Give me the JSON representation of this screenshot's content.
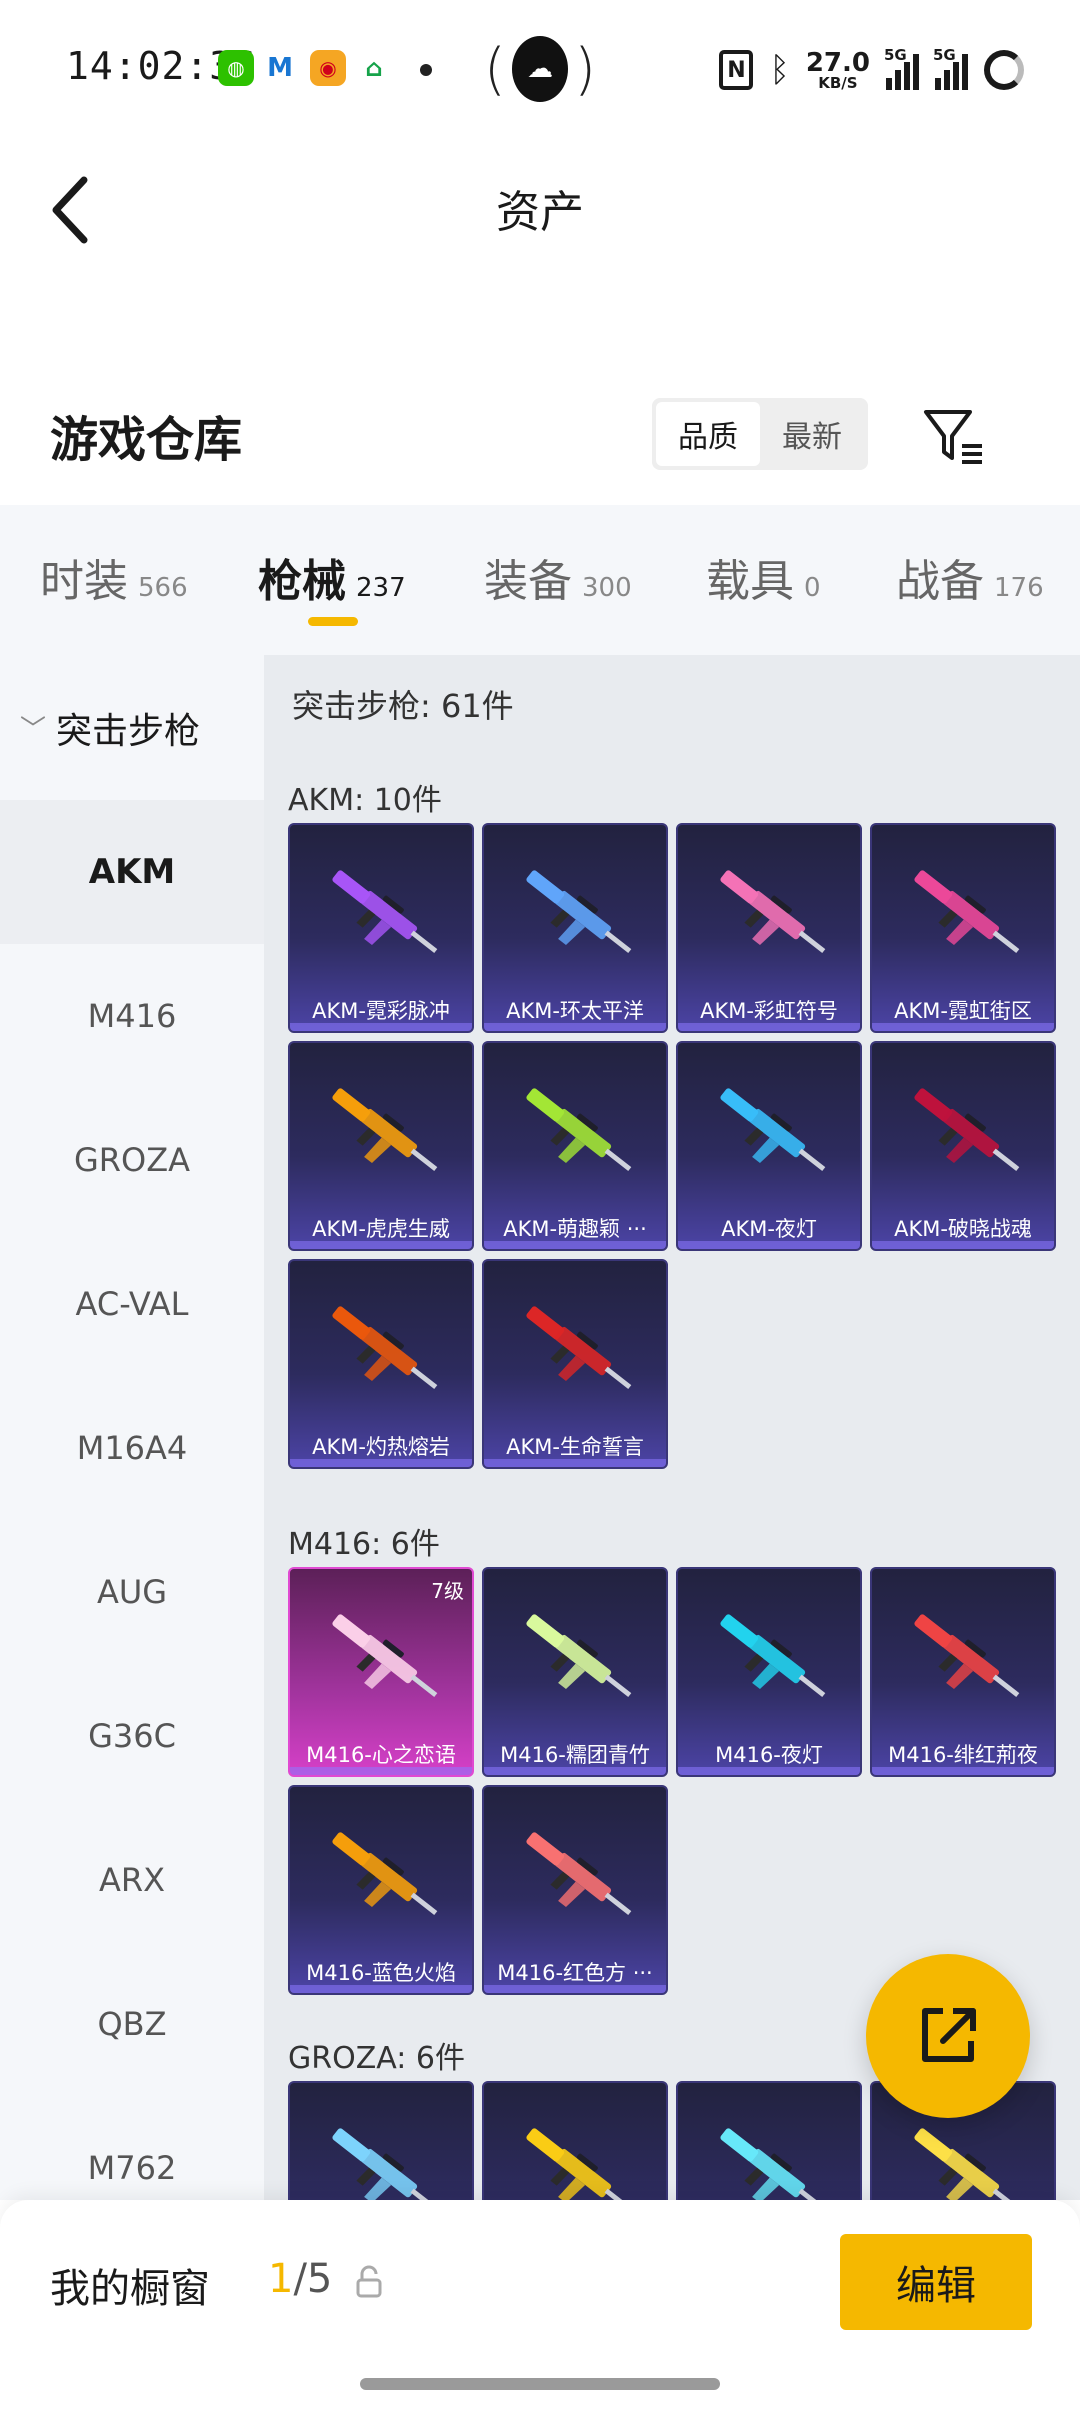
{
  "status_bar": {
    "time": "14:02:36",
    "net_speed_value": "27.0",
    "net_speed_unit": "KB/S",
    "sig1_label": "5G",
    "sig2_label": "5G"
  },
  "nav": {
    "title": "资产"
  },
  "header": {
    "title": "游戏仓库",
    "sort_options": [
      "品质",
      "最新"
    ]
  },
  "tabs": [
    {
      "label": "时装",
      "count": "566"
    },
    {
      "label": "枪械",
      "count": "237"
    },
    {
      "label": "装备",
      "count": "300"
    },
    {
      "label": "载具",
      "count": "0"
    },
    {
      "label": "战备",
      "count": "176"
    }
  ],
  "sidebar": {
    "category": "突击步枪",
    "items": [
      "AKM",
      "M416",
      "GROZA",
      "AC-VAL",
      "M16A4",
      "AUG",
      "G36C",
      "ARX",
      "QBZ",
      "M762"
    ]
  },
  "content": {
    "summary": "突击步枪: 61件",
    "groups": [
      {
        "title": "AKM: 10件",
        "items": [
          {
            "name": "AKM-霓彩脉冲",
            "accent": "#a855f7"
          },
          {
            "name": "AKM-环太平洋",
            "accent": "#60a5fa"
          },
          {
            "name": "AKM-彩虹符号",
            "accent": "#f472b6"
          },
          {
            "name": "AKM-霓虹街区",
            "accent": "#ec4899"
          },
          {
            "name": "AKM-虎虎生威",
            "accent": "#f59e0b"
          },
          {
            "name": "AKM-萌趣颖 ···",
            "accent": "#a3e635"
          },
          {
            "name": "AKM-夜灯",
            "accent": "#38bdf8"
          },
          {
            "name": "AKM-破晓战魂",
            "accent": "#be123c"
          },
          {
            "name": "AKM-灼热熔岩",
            "accent": "#ea580c"
          },
          {
            "name": "AKM-生命誓言",
            "accent": "#dc2626"
          }
        ]
      },
      {
        "title": "M416: 6件",
        "items": [
          {
            "name": "M416-心之恋语",
            "accent": "#fbcfe8",
            "level": "7级"
          },
          {
            "name": "M416-糯团青竹",
            "accent": "#d9f99d"
          },
          {
            "name": "M416-夜灯",
            "accent": "#22d3ee"
          },
          {
            "name": "M416-绯红荊夜",
            "accent": "#ef4444"
          },
          {
            "name": "M416-蓝色火焰",
            "accent": "#f59e0b"
          },
          {
            "name": "M416-红色方 ···",
            "accent": "#f87171"
          }
        ]
      },
      {
        "title": "GROZA: 6件",
        "items": [
          {
            "name": "",
            "accent": "#7dd3fc"
          },
          {
            "name": "",
            "accent": "#facc15"
          },
          {
            "name": "",
            "accent": "#67e8f9"
          },
          {
            "name": "",
            "accent": "#fde047"
          }
        ]
      }
    ]
  },
  "bottom": {
    "showcase_label": "我的橱窗",
    "showcase_current": "1",
    "showcase_total": "/5",
    "edit_label": "编辑"
  },
  "colors": {
    "accent": "#f5b800",
    "sidebar_bg": "#f5f7fa",
    "content_bg": "#e8ebef"
  },
  "icons": [
    "back-icon",
    "filter-icon",
    "share-icon",
    "lock-icon",
    "chevron-down-icon"
  ]
}
